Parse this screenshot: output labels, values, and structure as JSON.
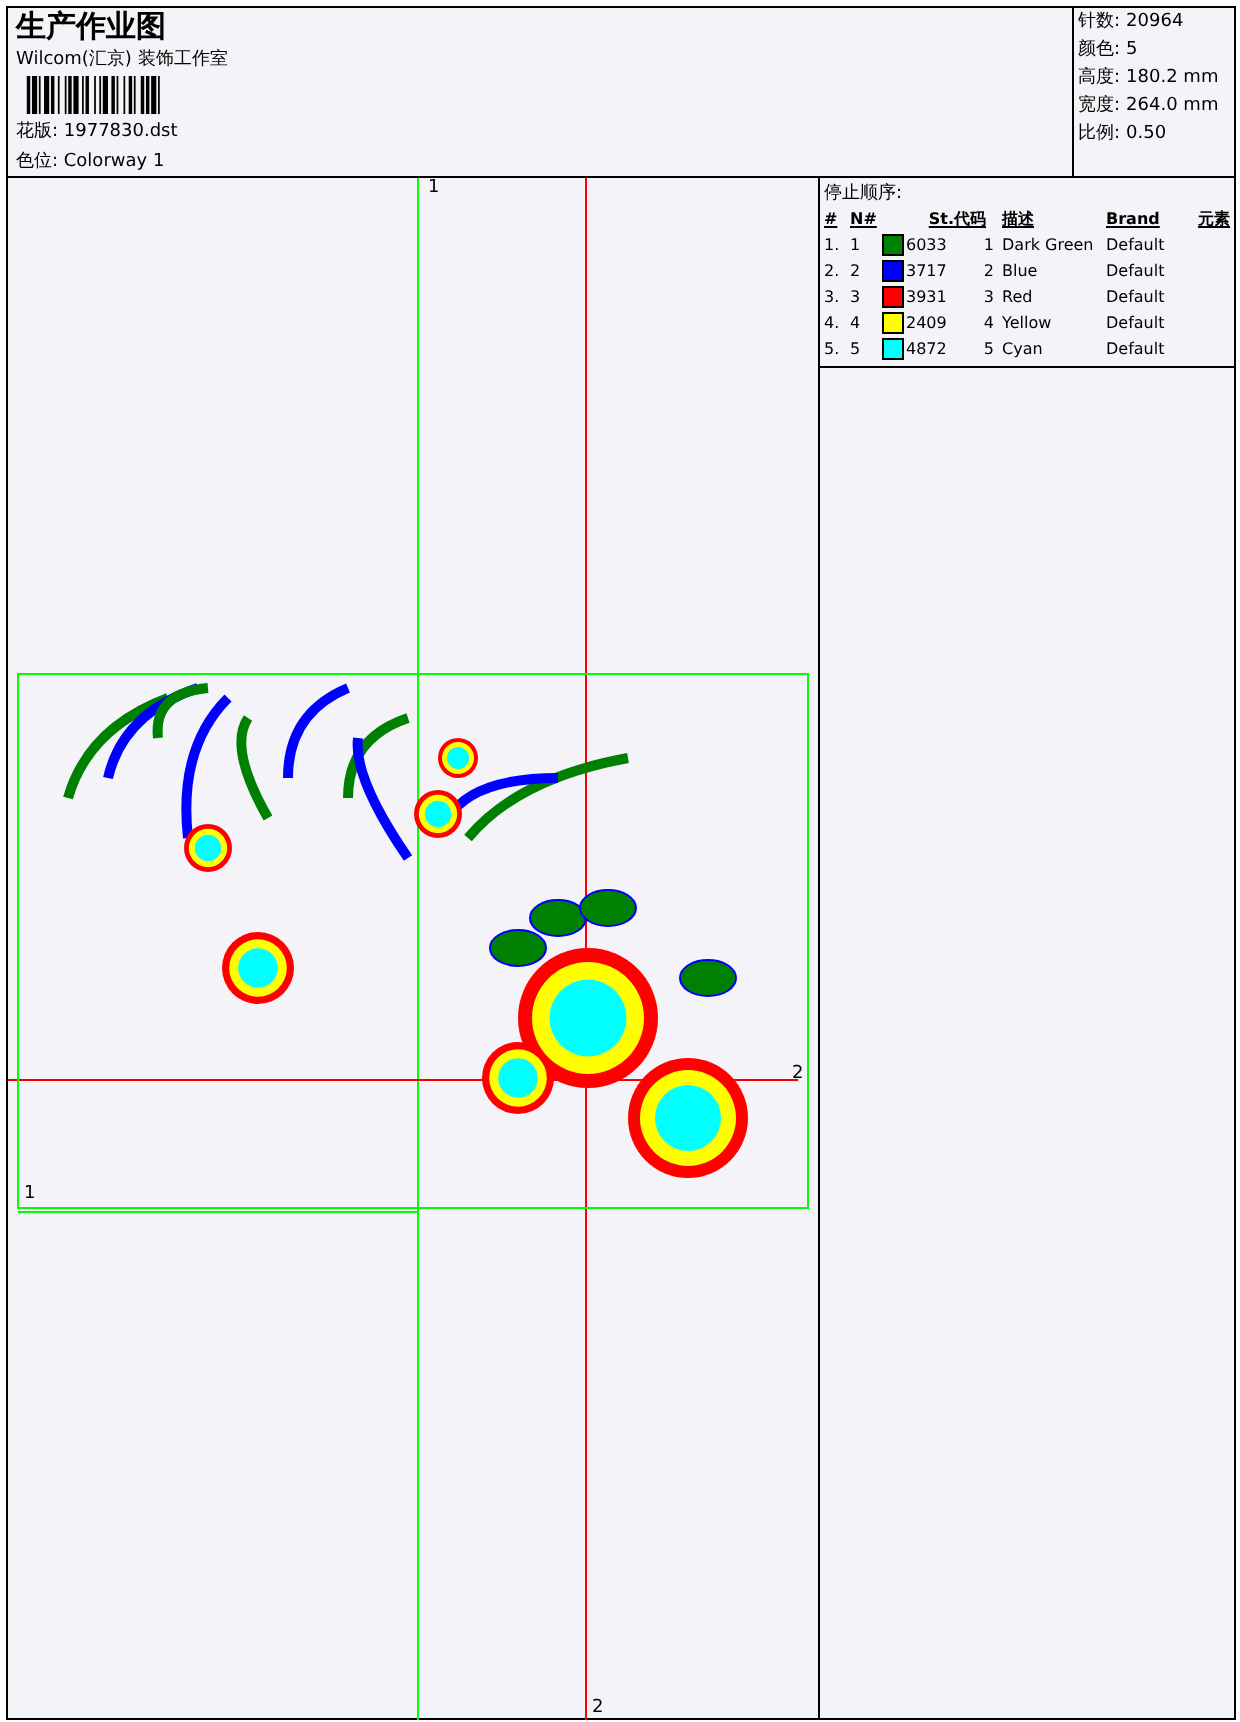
{
  "header": {
    "title": "生产作业图",
    "company": "Wilcom(汇京) 装饰工作室",
    "design_file": "花版: 1977830.dst",
    "colorway": "色位: Colorway 1"
  },
  "stats": [
    {
      "label": "针数:",
      "value": "20964"
    },
    {
      "label": "颜色:",
      "value": "5"
    },
    {
      "label": "高度:",
      "value": "180.2 mm"
    },
    {
      "label": "宽度:",
      "value": "264.0 mm"
    },
    {
      "label": "比例:",
      "value": "0.50"
    }
  ],
  "canvas": {
    "guide_labels": [
      {
        "kind": "top",
        "text": "1"
      },
      {
        "kind": "bottom",
        "text": "2"
      },
      {
        "kind": "right",
        "text": "2"
      },
      {
        "kind": "left",
        "text": "1"
      }
    ]
  },
  "stop_sequence": {
    "title": "停止顺序:",
    "columns": [
      "#",
      "N#",
      "St.",
      "代码",
      "描述",
      "Brand",
      "元素"
    ],
    "rows": [
      {
        "index": "1.",
        "no": "1",
        "color": "#008000",
        "stitches": "6033",
        "code": "1",
        "description": "Dark Green",
        "brand": "Default"
      },
      {
        "index": "2.",
        "no": "2",
        "color": "#0000ff",
        "stitches": "3717",
        "code": "2",
        "description": "Blue",
        "brand": "Default"
      },
      {
        "index": "3.",
        "no": "3",
        "color": "#ff0000",
        "stitches": "3931",
        "code": "3",
        "description": "Red",
        "brand": "Default"
      },
      {
        "index": "4.",
        "no": "4",
        "color": "#ffff00",
        "stitches": "2409",
        "code": "4",
        "description": "Yellow",
        "brand": "Default"
      },
      {
        "index": "5.",
        "no": "5",
        "color": "#00ffff",
        "stitches": "4872",
        "code": "5",
        "description": "Cyan",
        "brand": "Default"
      }
    ]
  }
}
